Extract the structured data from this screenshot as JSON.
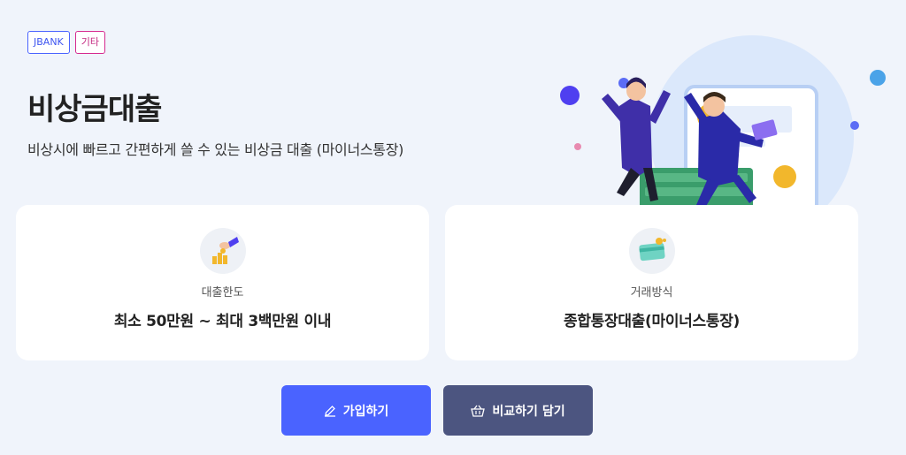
{
  "tags": [
    "JBANK",
    "기타"
  ],
  "product": {
    "title": "비상금대출",
    "subtitle": "비상시에 빠르고 간편하게 쓸 수 있는 비상금 대출 (마이너스통장)"
  },
  "cards": [
    {
      "label": "대출한도",
      "value": "최소 50만원 ~ 최대 3백만원 이내",
      "icon": "hand-coins-icon"
    },
    {
      "label": "거래방식",
      "value": "종합통장대출(마이너스통장)",
      "icon": "credit-card-icon"
    }
  ],
  "buttons": {
    "join_label": "가입하기",
    "compare_label": "비교하기 담기"
  },
  "colors": {
    "primary": "#4a63ff",
    "secondary": "#4c5580",
    "background": "#f0f4fb"
  }
}
